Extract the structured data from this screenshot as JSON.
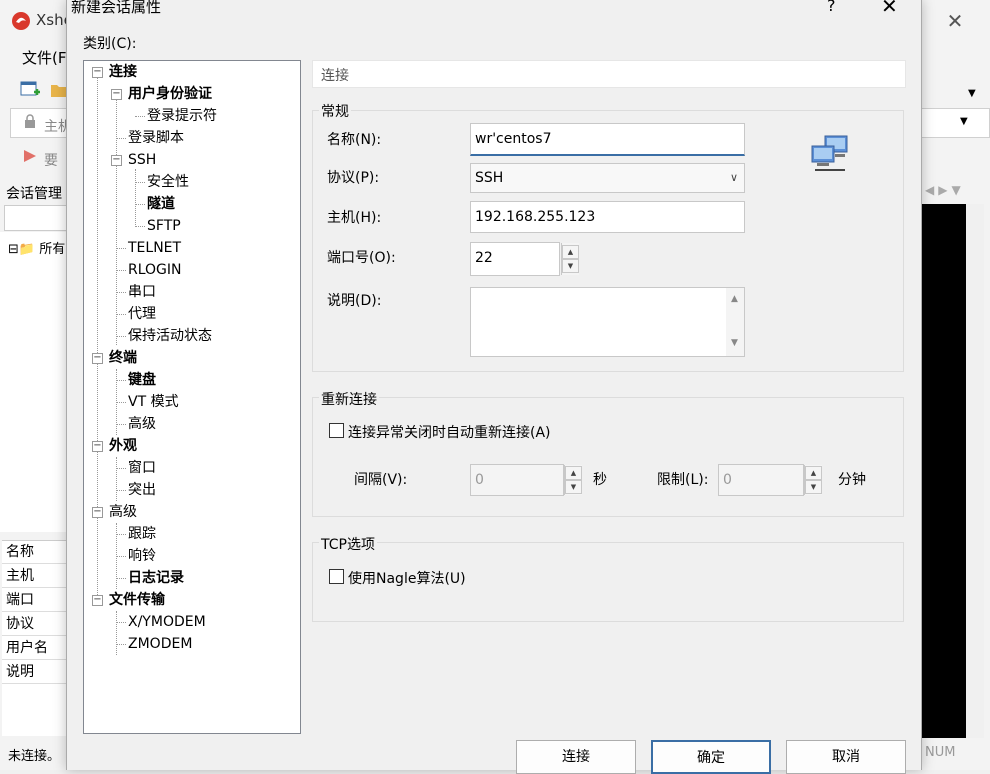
{
  "background_app": {
    "title": "Xshe",
    "menu_file": "文件(F",
    "address_label": "主机",
    "row2_label": "要",
    "session_title": "会话管理",
    "tree_root": "所有",
    "props": [
      "名称",
      "主机",
      "端口",
      "协议",
      "用户名",
      "说明"
    ],
    "status": "未连接。",
    "num": "NUM"
  },
  "dialog": {
    "title": "新建会话属性",
    "help": "?",
    "close": "✕",
    "category_label": "类别(C):",
    "tree": {
      "connection": "连接",
      "auth": "用户身份验证",
      "login_prompt": "登录提示符",
      "login_script": "登录脚本",
      "ssh": "SSH",
      "security": "安全性",
      "tunnel": "隧道",
      "sftp": "SFTP",
      "telnet": "TELNET",
      "rlogin": "RLOGIN",
      "serial": "串口",
      "proxy": "代理",
      "keepalive": "保持活动状态",
      "terminal": "终端",
      "keyboard": "键盘",
      "vt_mode": "VT 模式",
      "terminal_advanced": "高级",
      "appearance": "外观",
      "window": "窗口",
      "highlight": "突出",
      "advanced": "高级",
      "trace": "跟踪",
      "bell": "响铃",
      "logging": "日志记录",
      "file_transfer": "文件传输",
      "xymodem": "X/YMODEM",
      "zmodem": "ZMODEM"
    },
    "section_header": "连接",
    "general": {
      "title": "常规",
      "name_label": "名称(N):",
      "name_value": "wr'centos7",
      "protocol_label": "协议(P):",
      "protocol_value": "SSH",
      "host_label": "主机(H):",
      "host_value": "192.168.255.123",
      "port_label": "端口号(O):",
      "port_value": "22",
      "desc_label": "说明(D):"
    },
    "reconnect": {
      "title": "重新连接",
      "checkbox_label": "连接异常关闭时自动重新连接(A)",
      "interval_label": "间隔(V):",
      "interval_value": "0",
      "interval_unit": "秒",
      "limit_label": "限制(L):",
      "limit_value": "0",
      "limit_unit": "分钟"
    },
    "tcp": {
      "title": "TCP选项",
      "nagle_label": "使用Nagle算法(U)"
    },
    "buttons": {
      "connect": "连接",
      "ok": "确定",
      "cancel": "取消"
    }
  }
}
